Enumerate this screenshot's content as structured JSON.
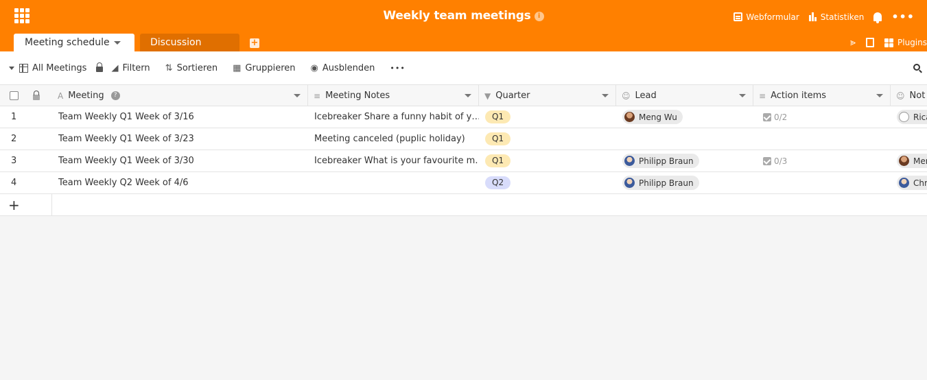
{
  "header": {
    "title": "Weekly team meetings",
    "info": "i",
    "actions": [
      {
        "label": "Webformular",
        "icon": "form-icon"
      },
      {
        "label": "Statistiken",
        "icon": "statistics-icon"
      }
    ],
    "more": "•••"
  },
  "tabs": [
    {
      "label": "Meeting schedule",
      "active": true
    },
    {
      "label": "Discussion topics",
      "active": false
    }
  ],
  "add_tab": "+",
  "right_tabs": {
    "plugins_label": "Plugins"
  },
  "toolbar": {
    "view_label": "All Meetings",
    "filter_label": "Filtern",
    "sort_label": "Sortieren",
    "group_label": "Gruppieren",
    "hide_label": "Ausblenden",
    "more": "•••"
  },
  "columns": [
    {
      "label": "Meeting",
      "icon": "A"
    },
    {
      "label": "Meeting Notes",
      "icon": "≡"
    },
    {
      "label": "Quarter",
      "icon": "▼"
    },
    {
      "label": "Lead",
      "icon": "☺"
    },
    {
      "label": "Action items",
      "icon": "≡"
    },
    {
      "label": "Not",
      "icon": "☺"
    }
  ],
  "rows": [
    {
      "index": "1",
      "meeting": "Team Weekly Q1 Week of 3/16",
      "notes": "Icebreaker Share a funny habit of y…",
      "quarter": "Q1",
      "lead": "Meng Wu",
      "action_items": "0/2",
      "notes_person": "Rica"
    },
    {
      "index": "2",
      "meeting": "Team Weekly Q1 Week of 3/23",
      "notes": "Meeting canceled (puplic holiday)",
      "quarter": "Q1",
      "lead": "",
      "action_items": "",
      "notes_person": ""
    },
    {
      "index": "3",
      "meeting": "Team Weekly Q1 Week of 3/30",
      "notes": "Icebreaker What is your favourite m…",
      "quarter": "Q1",
      "lead": "Philipp Braun",
      "action_items": "0/3",
      "notes_person": "Men"
    },
    {
      "index": "4",
      "meeting": "Team Weekly Q2 Week of 4/6",
      "notes": "",
      "quarter": "Q2",
      "lead": "Philipp Braun",
      "action_items": "",
      "notes_person": "Chri"
    }
  ],
  "add_row": "+",
  "colors": {
    "brand": "#ff8000",
    "q1": "#fde9b3",
    "q2": "#d8dcfb"
  }
}
